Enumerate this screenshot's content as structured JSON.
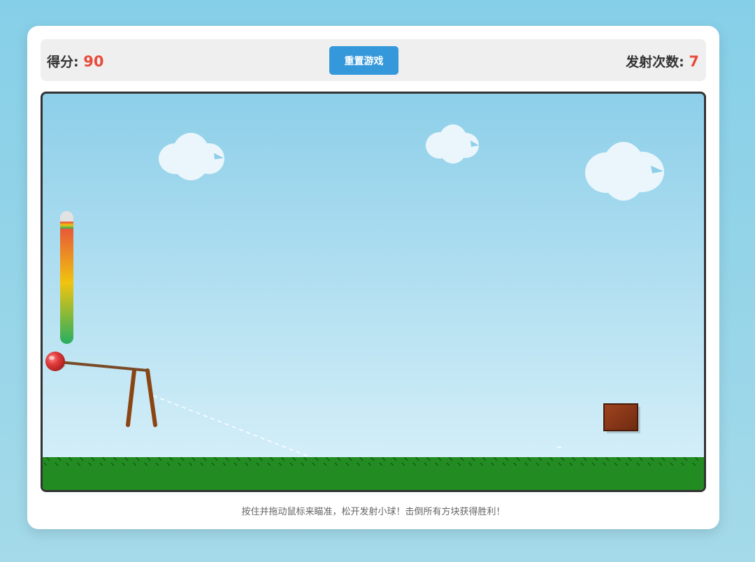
{
  "header": {
    "score_label": "得分: ",
    "score_value": "90",
    "reset_label": "重置游戏",
    "shots_label": "发射次数: ",
    "shots_value": "7"
  },
  "game": {
    "power_level": 0.92,
    "colors": {
      "ball": "#e03b3b",
      "block": "#8b3a1a",
      "grass": "#228b22",
      "slingshot": "#8b4513",
      "power_top": "#e74c3c",
      "power_mid": "#f1c40f",
      "power_bottom": "#27ae60"
    },
    "icons": [
      "cloud-icon",
      "ball-icon",
      "slingshot-icon",
      "block-icon"
    ]
  },
  "footer": {
    "hint": "按住并拖动鼠标来瞄准，松开发射小球！击倒所有方块获得胜利！"
  }
}
